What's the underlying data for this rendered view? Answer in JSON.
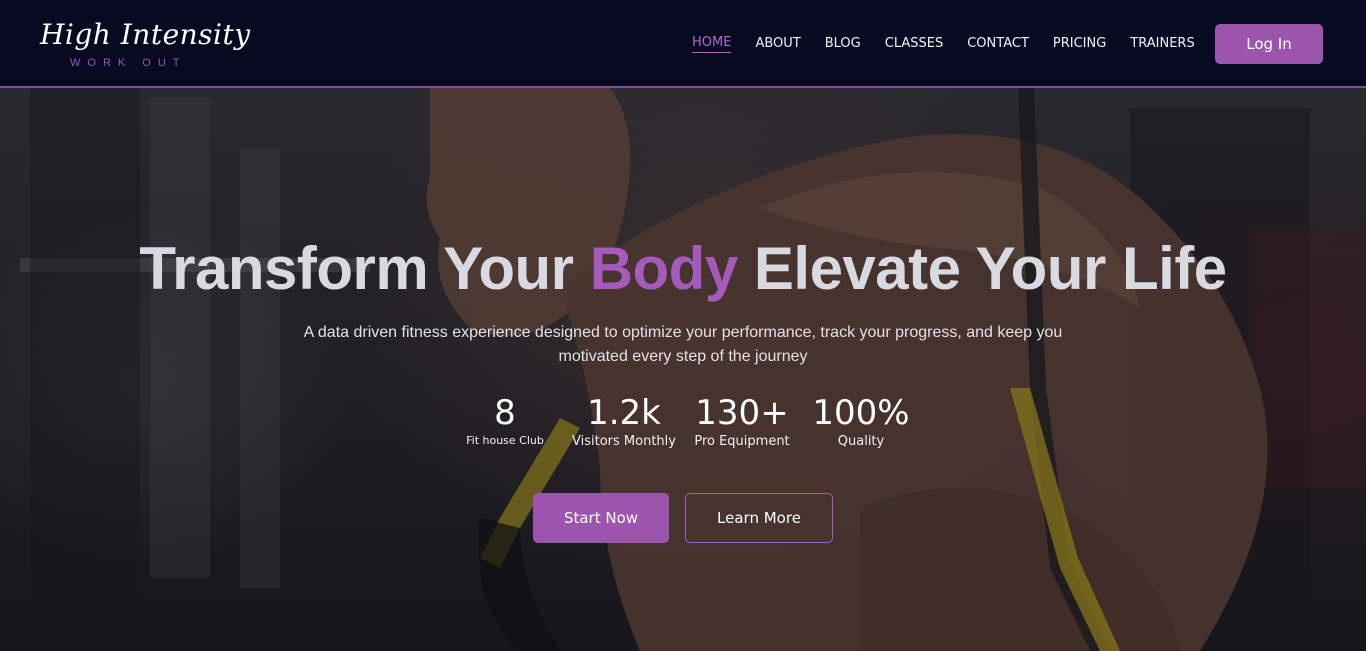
{
  "brand": {
    "name": "High Intensity",
    "tagline": "WORK OUT"
  },
  "nav": {
    "items": [
      {
        "label": "HOME",
        "active": true
      },
      {
        "label": "ABOUT",
        "active": false
      },
      {
        "label": "BLOG",
        "active": false
      },
      {
        "label": "CLASSES",
        "active": false
      },
      {
        "label": "CONTACT",
        "active": false
      },
      {
        "label": "PRICING",
        "active": false
      },
      {
        "label": "TRAINERS",
        "active": false
      }
    ],
    "login_label": "Log In"
  },
  "hero": {
    "title_part1": "Transform Your ",
    "title_accent": "Body",
    "title_part2": " Elevate Your Life",
    "subtitle": "A data driven fitness experience designed to optimize your performance, track your progress, and keep you motivated every step of the journey",
    "stats": [
      {
        "value": "8",
        "label": "Fit house Club"
      },
      {
        "value": "1.2k",
        "label": "Visitors Monthly"
      },
      {
        "value": "130+",
        "label": "Pro Equipment"
      },
      {
        "value": "100%",
        "label": "Quality"
      }
    ],
    "primary_cta": "Start Now",
    "secondary_cta": "Learn More"
  },
  "colors": {
    "accent": "#9b55ad",
    "accent_text": "#a55bbc",
    "nav_bg": "#080a22"
  }
}
